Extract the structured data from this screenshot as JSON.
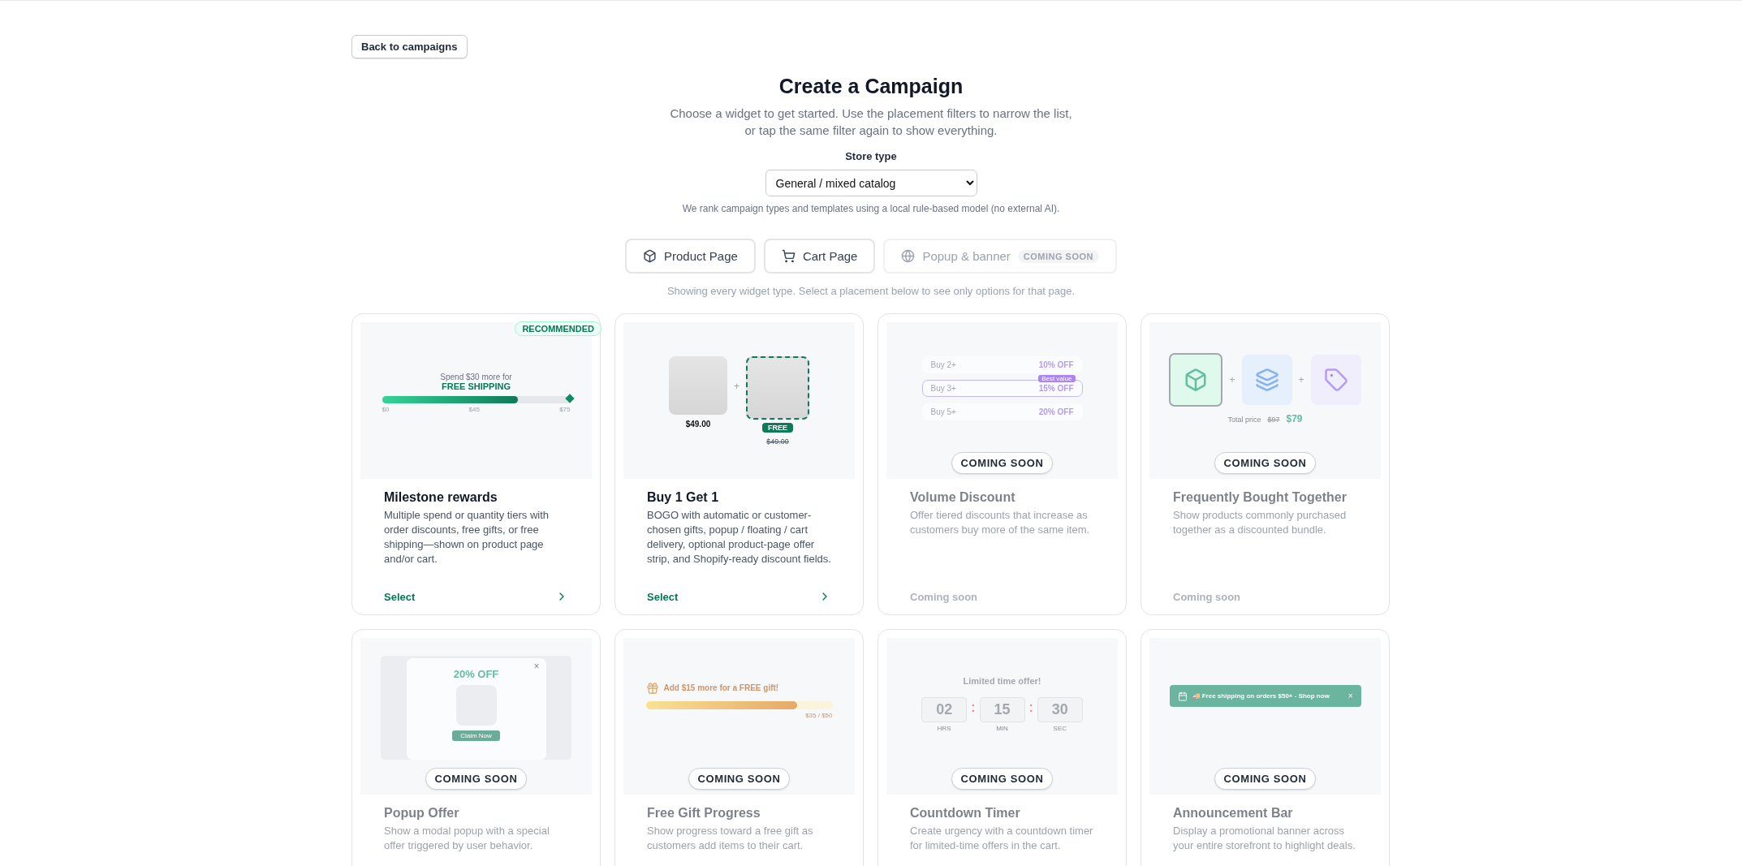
{
  "back_button": {
    "label": "Back to campaigns"
  },
  "header": {
    "title": "Create a Campaign",
    "subtitle_lines": [
      "Choose a widget to get started. Use the placement filters to narrow the list,",
      "or tap the same filter again to show everything."
    ]
  },
  "store_type": {
    "label": "Store type",
    "value": "General / mixed catalog",
    "note": "We rank campaign types and templates using a local rule-based model (no external AI)."
  },
  "filters": [
    {
      "label": "Product Page",
      "selected": false,
      "disabled": false
    },
    {
      "label": "Cart Page",
      "selected": false,
      "disabled": false
    },
    {
      "label": "Popup & banner",
      "selected": false,
      "disabled": true,
      "badge": "COMING SOON"
    }
  ],
  "filter_hint": "Showing every widget type. Select a placement below to see only options for that page.",
  "cards": [
    {
      "kind": "milestone",
      "title": "Milestone rewards",
      "description": "Multiple spend or quantity tiers with order discounts, free gifts, or free shipping—shown on product page and/or cart.",
      "available": true,
      "badge": "RECOMMENDED",
      "footer": "Select",
      "preview": {
        "line1": "Spend $30 more for",
        "line2": "FREE SHIPPING",
        "level": 0.72,
        "ticks": [
          "$0",
          "$45",
          "$75"
        ]
      }
    },
    {
      "kind": "bogo",
      "title": "Buy 1 Get 1",
      "description": "BOGO with automatic or customer-chosen gifts, popup / floating / cart delivery, optional product-page offer strip, and Shopify-ready discount fields.",
      "available": true,
      "footer": "Select",
      "preview": {
        "price": "$49.00",
        "plus": "+",
        "free_badge": "FREE",
        "old_price": "$49.00"
      }
    },
    {
      "kind": "volume",
      "title": "Volume Discount",
      "description": "Offer tiered discounts that increase as customers buy more of the same item.",
      "available": false,
      "overlay": "COMING SOON",
      "footer": "Coming soon",
      "preview": {
        "tiers": [
          {
            "label": "Buy 2+",
            "discount": "10% OFF",
            "selected": false
          },
          {
            "label": "Buy 3+",
            "discount": "15% OFF",
            "selected": true,
            "tag": "Best value"
          },
          {
            "label": "Buy 5+",
            "discount": "20% OFF",
            "selected": false
          }
        ]
      }
    },
    {
      "kind": "bundle",
      "title": "Frequently Bought Together",
      "description": "Show products commonly purchased together as a discounted bundle.",
      "available": false,
      "overlay": "COMING SOON",
      "footer": "Coming soon",
      "preview": {
        "plus": "+",
        "total_label": "Total price",
        "old_price": "$97",
        "new_price": "$79"
      }
    },
    {
      "kind": "popup",
      "title": "Popup Offer",
      "description": "Show a modal popup with a special offer triggered by user behavior.",
      "available": false,
      "overlay": "COMING SOON",
      "preview": {
        "discount": "20% OFF",
        "cta": "Claim Now",
        "close": "×"
      }
    },
    {
      "kind": "gift",
      "title": "Free Gift Progress",
      "description": "Show progress toward a free gift as customers add items to their cart.",
      "available": false,
      "overlay": "COMING SOON",
      "preview": {
        "message": "Add $15 more for a FREE gift!",
        "level": 0.81,
        "reading": "$35 / $50"
      }
    },
    {
      "kind": "countdown",
      "title": "Countdown Timer",
      "description": "Create urgency with a countdown timer for limited-time offers in the cart.",
      "available": false,
      "overlay": "COMING SOON",
      "preview": {
        "heading": "Limited time offer!",
        "separator": ":",
        "units": [
          {
            "value": "02",
            "label": "HRS"
          },
          {
            "value": "15",
            "label": "MIN"
          },
          {
            "value": "30",
            "label": "SEC"
          }
        ]
      }
    },
    {
      "kind": "announcement",
      "title": "Announcement Bar",
      "description": "Display a promotional banner across your entire storefront to highlight deals.",
      "available": false,
      "overlay": "COMING SOON",
      "preview": {
        "text": "🚚 Free shipping on orders $50+ - Shop now",
        "close": "×"
      }
    }
  ]
}
